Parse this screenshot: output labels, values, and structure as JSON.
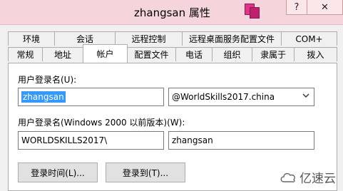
{
  "window": {
    "title": "zhangsan 属性",
    "help_label": "?",
    "close_label": "✕"
  },
  "tabs_row1": [
    "环境",
    "会话",
    "远程控制",
    "远程桌面服务配置文件",
    "COM+"
  ],
  "tabs_row2": [
    "常规",
    "地址",
    "帐户",
    "配置文件",
    "电话",
    "组织",
    "隶属于",
    "拨入"
  ],
  "active_tab": "帐户",
  "account": {
    "logon_name_label": "用户登录名(U):",
    "logon_name_value": "zhangsan",
    "domain_suffix": "@WorldSkills2017.china",
    "pre2000_label": "用户登录名(Windows 2000 以前版本)(W):",
    "pre2000_domain": "WORLDSKILLS2017\\",
    "pre2000_name": "zhangsan",
    "logon_hours_button": "登录时间(L)...",
    "logon_to_button": "登录到(T)..."
  },
  "watermark": {
    "text": "亿速云"
  }
}
